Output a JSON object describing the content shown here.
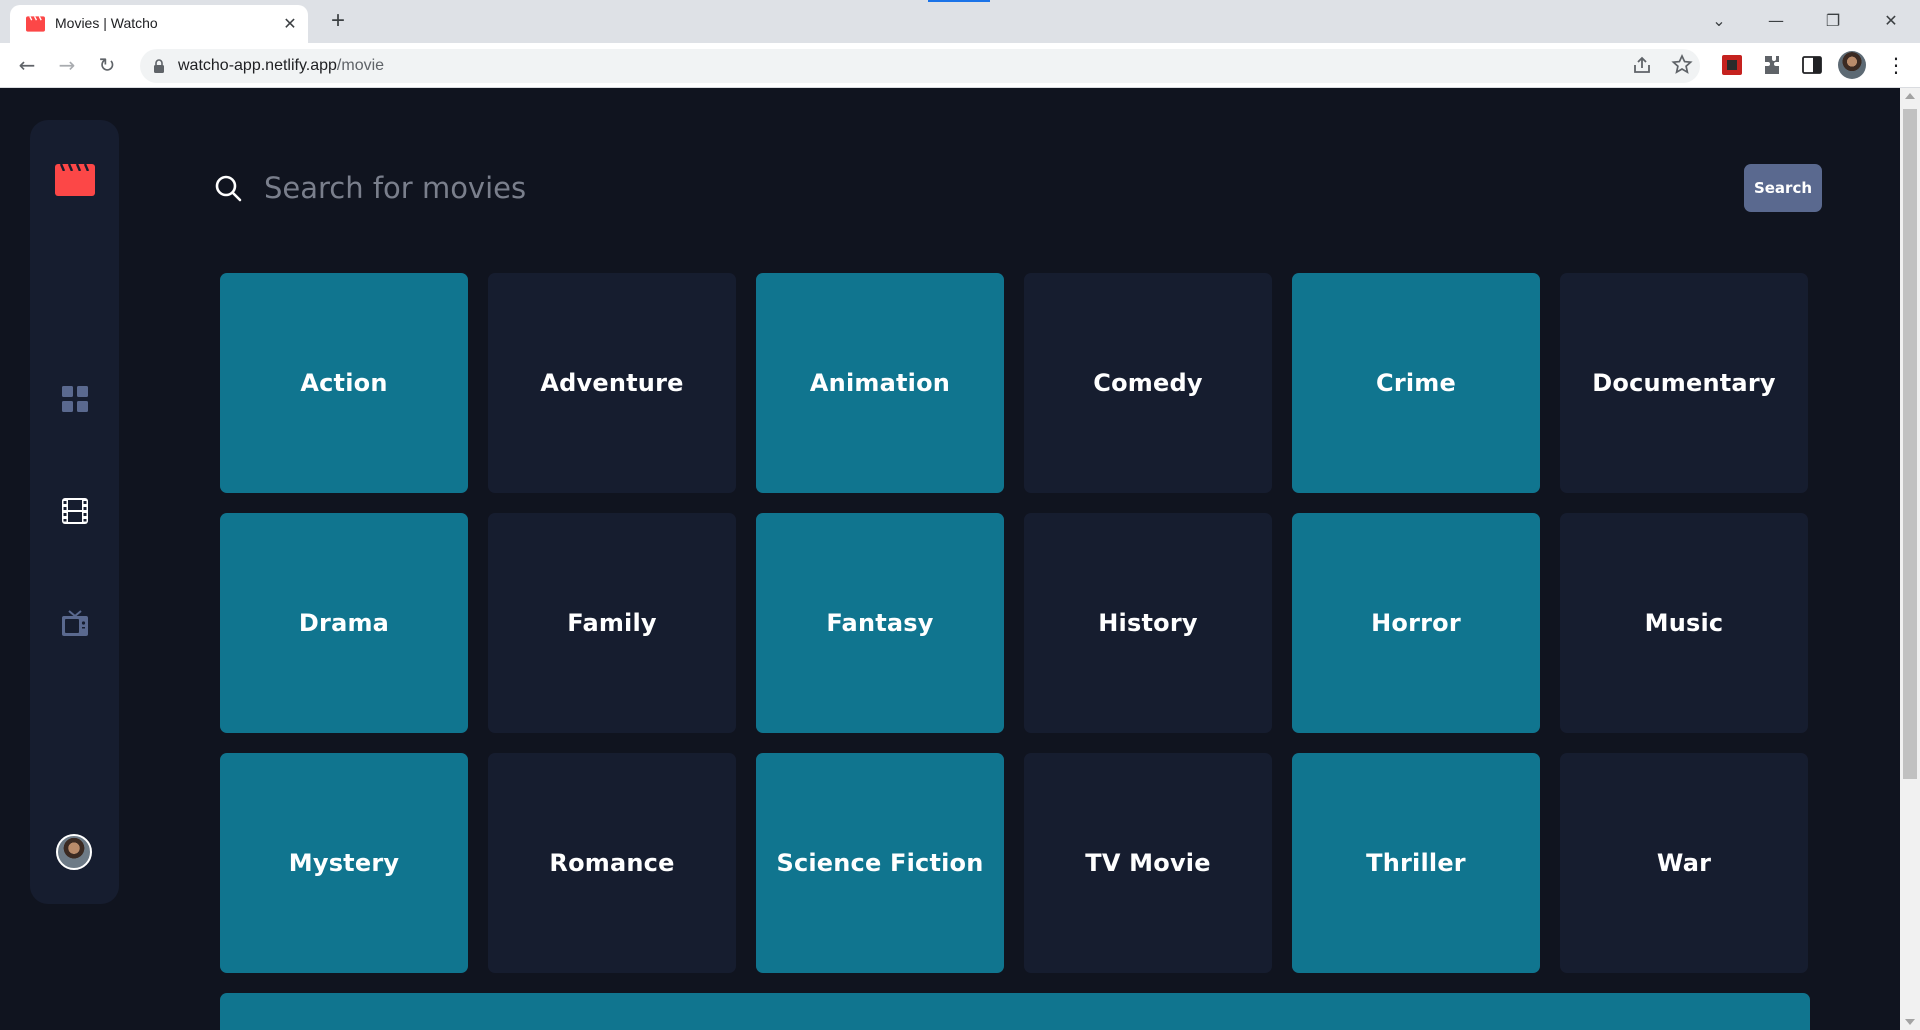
{
  "browser": {
    "tab_title": "Movies | Watcho",
    "url_host": "watcho-app.netlify.app",
    "url_path": "/movie",
    "new_tab_symbol": "+",
    "close_symbol": "✕",
    "minimize_symbol": "—",
    "maximize_symbol": "❐",
    "window_close_symbol": "✕",
    "tab_search_symbol": "⌄",
    "back_symbol": "←",
    "forward_symbol": "→",
    "reload_symbol": "↻",
    "menu_symbol": "⋮"
  },
  "colors": {
    "background": "#10141f",
    "sidebar": "#161d2f",
    "teal_card": "#10758f",
    "dark_card": "#161d2f",
    "logo_red": "#fc4747",
    "nav_inactive": "#5a698f",
    "nav_active": "#ffffff",
    "search_button": "#5a698f"
  },
  "sidebar": {
    "logo_icon": "clapperboard-icon",
    "nav": [
      {
        "name": "home",
        "icon": "grid-icon",
        "active": false
      },
      {
        "name": "movies",
        "icon": "film-icon",
        "active": true
      },
      {
        "name": "tv-series",
        "icon": "tv-icon",
        "active": false
      }
    ],
    "avatar_icon": "user-avatar"
  },
  "search": {
    "placeholder": "Search for movies",
    "value": "",
    "button_label": "Search"
  },
  "genres": [
    {
      "label": "Action",
      "style": "teal"
    },
    {
      "label": "Adventure",
      "style": "dark"
    },
    {
      "label": "Animation",
      "style": "teal"
    },
    {
      "label": "Comedy",
      "style": "dark"
    },
    {
      "label": "Crime",
      "style": "teal"
    },
    {
      "label": "Documentary",
      "style": "dark"
    },
    {
      "label": "Drama",
      "style": "teal"
    },
    {
      "label": "Family",
      "style": "dark"
    },
    {
      "label": "Fantasy",
      "style": "teal"
    },
    {
      "label": "History",
      "style": "dark"
    },
    {
      "label": "Horror",
      "style": "teal"
    },
    {
      "label": "Music",
      "style": "dark"
    },
    {
      "label": "Mystery",
      "style": "teal"
    },
    {
      "label": "Romance",
      "style": "dark"
    },
    {
      "label": "Science Fiction",
      "style": "teal"
    },
    {
      "label": "TV Movie",
      "style": "dark"
    },
    {
      "label": "Thriller",
      "style": "teal"
    },
    {
      "label": "War",
      "style": "dark"
    }
  ]
}
